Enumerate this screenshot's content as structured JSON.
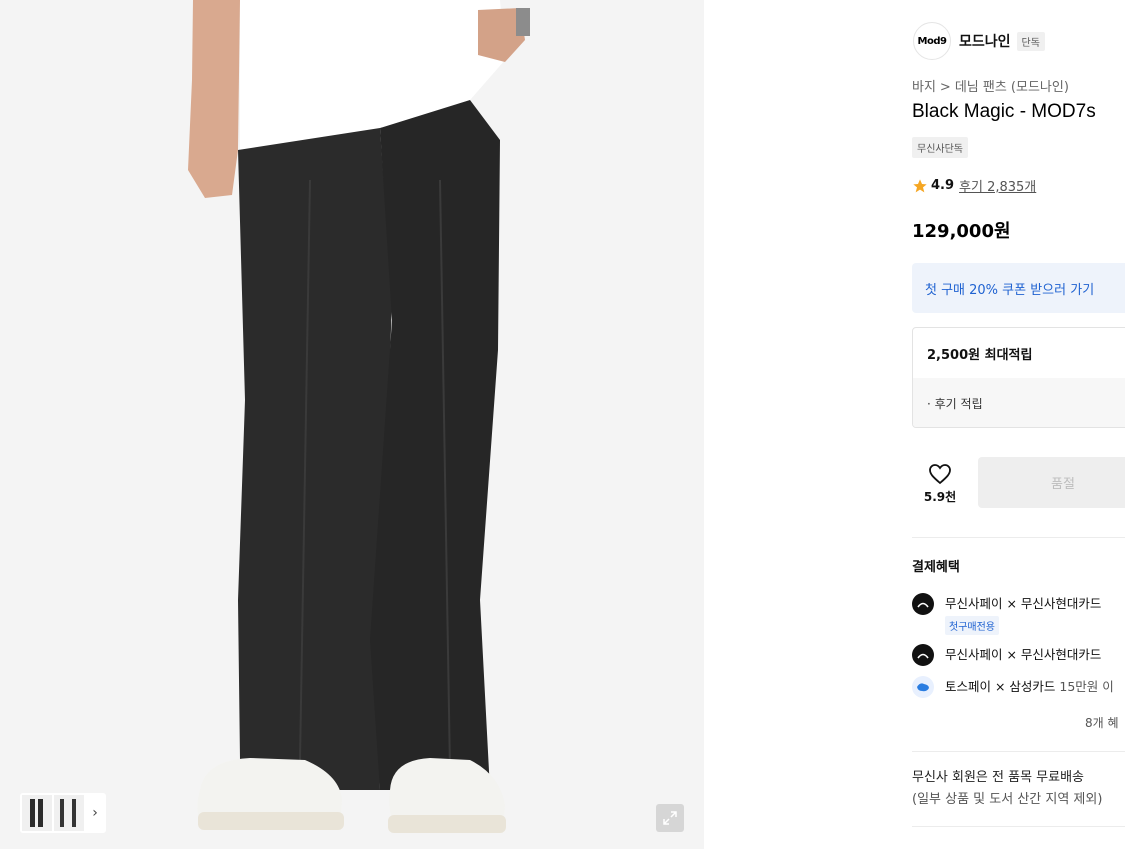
{
  "gallery": {
    "thumbnail_next": "›",
    "expand_icon": "expand-icon"
  },
  "brand": {
    "logo_text": "Mod9",
    "name": "모드나인",
    "badge": "단독"
  },
  "breadcrumb": {
    "category": "바지",
    "separator": ">",
    "subcategory": "데님 팬츠 (모드나인)"
  },
  "product": {
    "title": "Black Magic - MOD7s",
    "exclusive_tag": "무신사단독",
    "rating": "4.9",
    "reviews": "후기 2,835개",
    "price": "129,000원"
  },
  "coupon": {
    "label": "첫 구매 20% 쿠폰 받으러 가기"
  },
  "points": {
    "max_points": "2,500원 최대적립",
    "review_points": "· 후기 적립"
  },
  "actions": {
    "like_count": "5.9천",
    "soldout_label": "품절"
  },
  "benefits": {
    "title": "결제혜택",
    "items": [
      {
        "text": "무신사페이 × 무신사현대카드",
        "extra": "",
        "tag": "첫구매전용"
      },
      {
        "text": "무신사페이 × 무신사현대카드",
        "extra": "",
        "tag": ""
      },
      {
        "text": "토스페이 × 삼성카드",
        "extra": " 15만원 이",
        "tag": ""
      }
    ],
    "more": "8개 혜"
  },
  "shipping": {
    "line1": "무신사 회원은 전 품목 무료배송",
    "line2": "(일부 상품 및 도서 산간 지역 제외)"
  },
  "colors": {
    "accent_blue": "#1f62d1",
    "star": "#f5a623",
    "image_bg": "#f4f4f4"
  }
}
